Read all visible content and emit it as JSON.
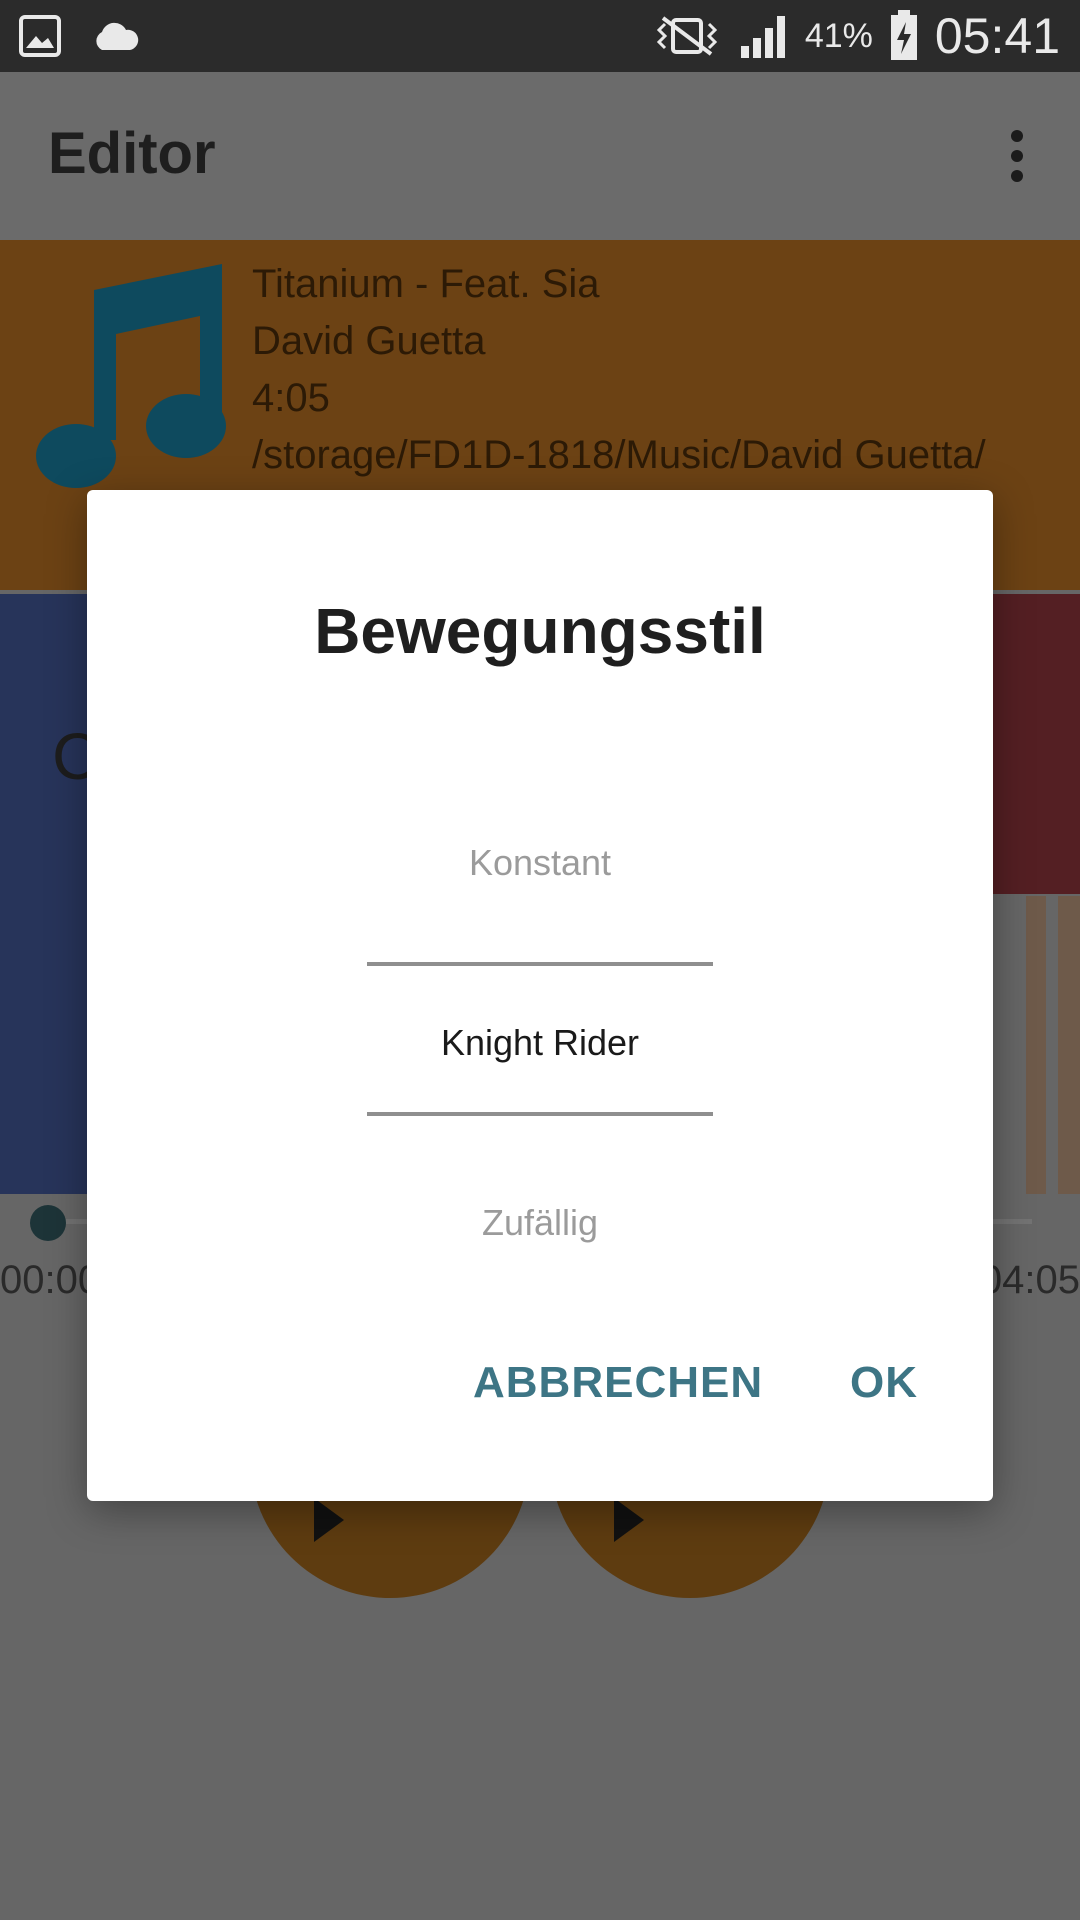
{
  "status_bar": {
    "left_icons": [
      "gallery-icon",
      "cloud-icon"
    ],
    "right_icons": [
      "vibrate-icon",
      "signal-icon",
      "battery-charging-icon"
    ],
    "battery": "41%",
    "time": "05:41"
  },
  "app_bar": {
    "title": "Editor",
    "menu_icon": "more-vert-icon"
  },
  "song": {
    "icon": "music-note-icon",
    "title": "Titanium - Feat. Sia",
    "artist": "David Guetta",
    "duration": "4:05",
    "path": "/storage/FD1D-1818/Music/David Guetta/"
  },
  "background": {
    "letter": "C",
    "time_start": "00:00",
    "time_end": "04:05"
  },
  "dialog": {
    "title": "Bewegungsstil",
    "options": [
      "Konstant",
      "Knight Rider",
      "Zufällig"
    ],
    "selected": "Knight Rider",
    "cancel_label": "ABBRECHEN",
    "ok_label": "OK"
  },
  "colors": {
    "status_bar": "#2b2b2b",
    "scrim": "#666666",
    "song_panel": "#6c4214",
    "music_icon": "#0e4a5e",
    "accent_button": "#3d7585"
  }
}
